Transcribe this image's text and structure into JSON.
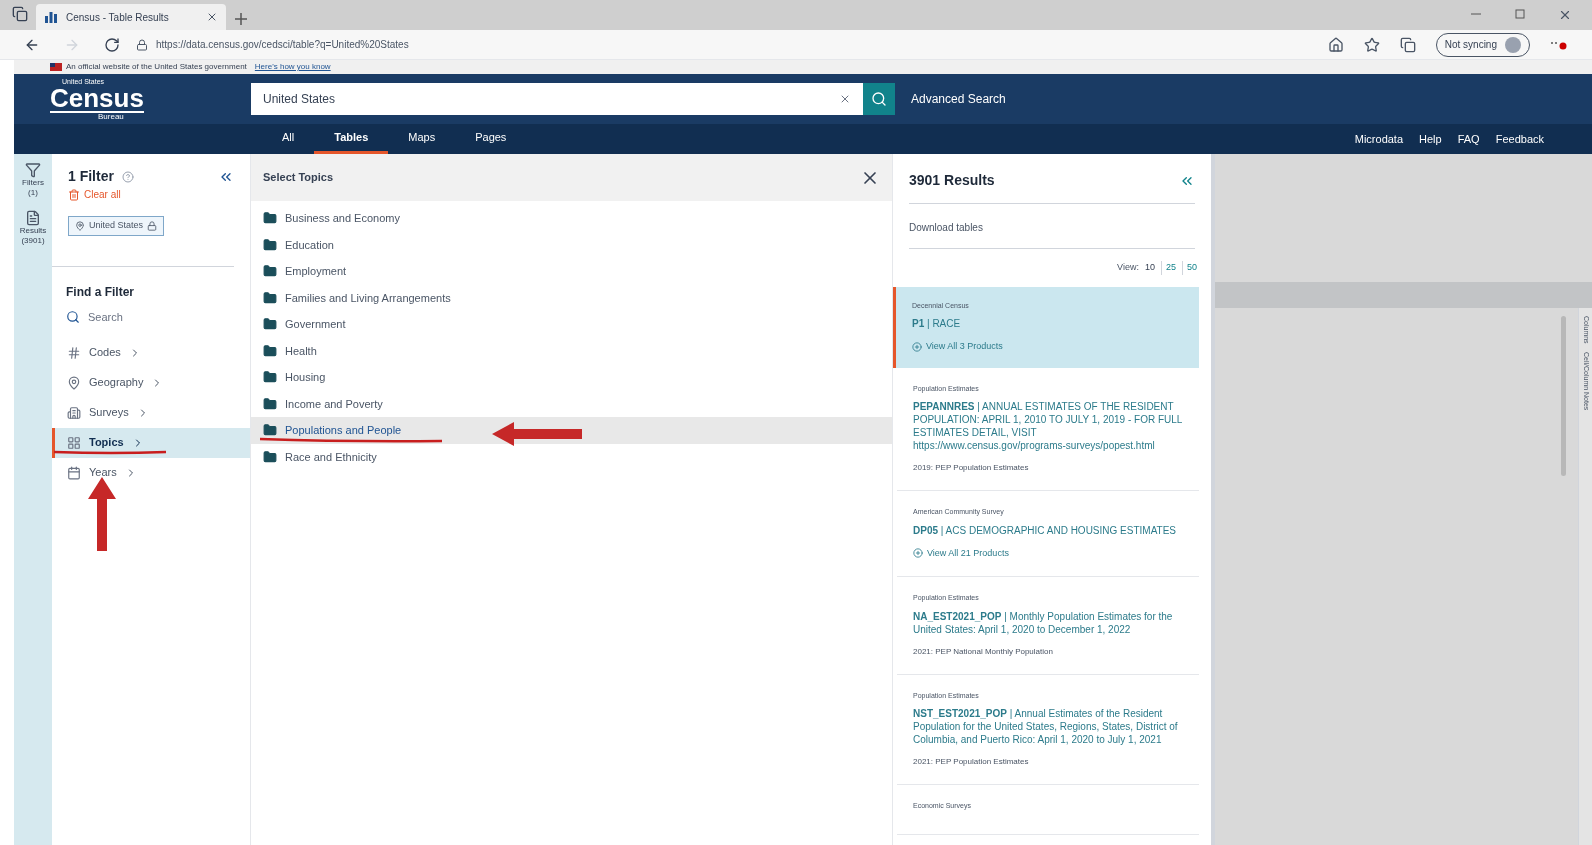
{
  "browser": {
    "tab_title": "Census - Table Results",
    "url": "https://data.census.gov/cedsci/table?q=United%20States",
    "sync_label": "Not syncing"
  },
  "gov_banner": {
    "text": "An official website of the United States government",
    "link": "Here's how you know"
  },
  "header": {
    "logo_top": "United States",
    "logo": "Census",
    "logo_bottom": "Bureau",
    "search_value": "United States",
    "advanced": "Advanced Search"
  },
  "nav": {
    "tabs": [
      {
        "label": "All",
        "selected": false
      },
      {
        "label": "Tables",
        "selected": true
      },
      {
        "label": "Maps",
        "selected": false
      },
      {
        "label": "Pages",
        "selected": false
      }
    ],
    "links": [
      "Microdata",
      "Help",
      "FAQ",
      "Feedback"
    ]
  },
  "rail": [
    {
      "kind": "filter",
      "label": "Filters",
      "count": "(1)"
    },
    {
      "kind": "results",
      "label": "Results",
      "count": "(3901)"
    }
  ],
  "filters": {
    "title": "1 Filter",
    "clear": "Clear all",
    "chips": [
      "United States"
    ],
    "find_title": "Find a Filter",
    "search_placeholder": "Search",
    "items": [
      {
        "kind": "codes",
        "label": "Codes",
        "selected": false
      },
      {
        "kind": "geography",
        "label": "Geography",
        "selected": false
      },
      {
        "kind": "surveys",
        "label": "Surveys",
        "selected": false
      },
      {
        "kind": "topics",
        "label": "Topics",
        "selected": true
      },
      {
        "kind": "years",
        "label": "Years",
        "selected": false
      }
    ]
  },
  "topics": {
    "title": "Select Topics",
    "items": [
      {
        "label": "Business and Economy",
        "selected": false
      },
      {
        "label": "Education",
        "selected": false
      },
      {
        "label": "Employment",
        "selected": false
      },
      {
        "label": "Families and Living Arrangements",
        "selected": false
      },
      {
        "label": "Government",
        "selected": false
      },
      {
        "label": "Health",
        "selected": false
      },
      {
        "label": "Housing",
        "selected": false
      },
      {
        "label": "Income and Poverty",
        "selected": false
      },
      {
        "label": "Populations and People",
        "selected": true
      },
      {
        "label": "Race and Ethnicity",
        "selected": false
      }
    ]
  },
  "results": {
    "title": "3901 Results",
    "download": "Download tables",
    "view_label": "View:",
    "view_options": [
      {
        "label": "10",
        "selected": true
      },
      {
        "label": "25",
        "selected": false
      },
      {
        "label": "50",
        "selected": false
      }
    ],
    "items": [
      {
        "survey": "Decennial Census",
        "title": "**P1** | RACE",
        "products": "View All 3 Products",
        "selected": true
      },
      {
        "survey": "Population Estimates",
        "title": "**PEPANNRES** | ANNUAL ESTIMATES OF THE RESIDENT POPULATION: APRIL 1, 2010 TO JULY 1, 2019 - FOR FULL ESTIMATES DETAIL, VISIT https://www.census.gov/programs-surveys/popest.html",
        "vintage": "2019: PEP Population Estimates",
        "selected": false
      },
      {
        "survey": "American Community Survey",
        "title": "**DP05** | ACS DEMOGRAPHIC AND HOUSING ESTIMATES",
        "products": "View All 21 Products",
        "selected": false
      },
      {
        "survey": "Population Estimates",
        "title": "**NA_EST2021_POP** | Monthly Population Estimates for the United States: April 1, 2020 to December 1, 2022",
        "vintage": "2021: PEP National Monthly Population",
        "selected": false
      },
      {
        "survey": "Population Estimates",
        "title": "**NST_EST2021_POP** | Annual Estimates of the Resident Population for the United States, Regions, States, District of Columbia, and Puerto Rico: April 1, 2020 to July 1, 2021",
        "vintage": "2021: PEP Population Estimates",
        "selected": false
      },
      {
        "survey": "Economic Surveys",
        "selected": false
      }
    ]
  },
  "side_tabs": [
    "Columns",
    "Cell/Column Notes"
  ]
}
